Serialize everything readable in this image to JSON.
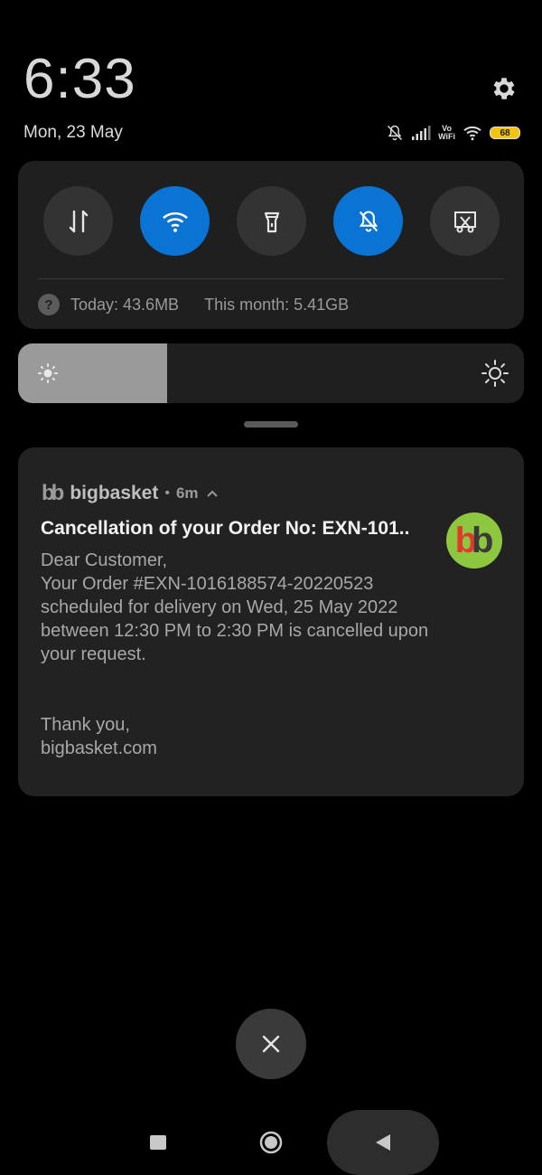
{
  "status": {
    "time": "6:33",
    "date": "Mon, 23 May",
    "vowifi_top": "Vo",
    "vowifi_bottom": "WiFi",
    "battery": "68"
  },
  "quick_settings": {
    "toggles": [
      {
        "name": "mobile-data",
        "icon": "data-transfer-icon",
        "active": false
      },
      {
        "name": "wifi",
        "icon": "wifi-icon",
        "active": true
      },
      {
        "name": "flashlight",
        "icon": "flashlight-icon",
        "active": false
      },
      {
        "name": "silent",
        "icon": "bell-off-icon",
        "active": true
      },
      {
        "name": "screenshot",
        "icon": "screenshot-icon",
        "active": false
      }
    ],
    "data_today": "Today: 43.6MB",
    "data_month": "This month: 5.41GB",
    "help_glyph": "?"
  },
  "brightness": {
    "level": 0.295
  },
  "notification": {
    "app_icon_glyph": "bb",
    "app_name": "bigbasket",
    "separator": "•",
    "time_ago": "6m",
    "title": "Cancellation of your Order No: EXN-101..",
    "body_lines": [
      "Dear Customer,",
      "Your Order #EXN-1016188574-20220523",
      "scheduled for delivery on Wed, 25 May 2022",
      "between 12:30 PM to 2:30 PM is cancelled upon",
      "your request."
    ],
    "signoff_lines": [
      "Thank you,",
      "bigbasket.com"
    ],
    "avatar_letters": [
      "b",
      "b"
    ]
  },
  "colors": {
    "accent": "#0a74d4",
    "panel": "#1f1f1f",
    "avatar_bg": "#8dc63f"
  }
}
